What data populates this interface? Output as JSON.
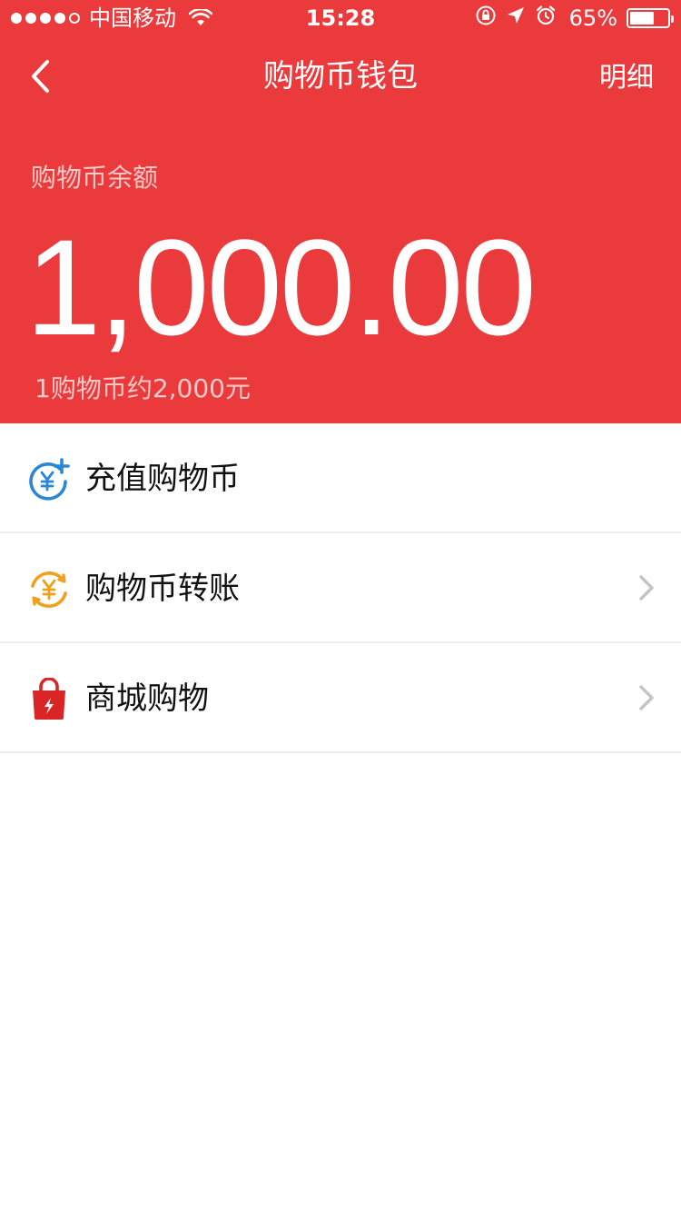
{
  "status_bar": {
    "carrier": "中国移动",
    "time": "15:28",
    "battery_percent": "65%",
    "battery_level": 0.65,
    "signal_bars": 4,
    "signal_total": 5
  },
  "nav": {
    "back_icon": "chevron-left-icon",
    "title": "购物币钱包",
    "right_link": "明细"
  },
  "balance": {
    "label": "购物币余额",
    "amount": "1,000.00",
    "rate_note": "1购物币约2,000元"
  },
  "menu": {
    "items": [
      {
        "label": "充值购物币",
        "icon": "recharge-coin-icon",
        "icon_color": "#2A86D6",
        "has_chevron": false
      },
      {
        "label": "购物币转账",
        "icon": "transfer-coin-icon",
        "icon_color": "#F0A11C",
        "has_chevron": true
      },
      {
        "label": "商城购物",
        "icon": "shopping-bag-icon",
        "icon_color": "#D92525",
        "has_chevron": true
      }
    ]
  },
  "colors": {
    "brand_red": "#EA3A3C",
    "divider": "#ECECEC",
    "chevron": "#C4C4C4"
  }
}
